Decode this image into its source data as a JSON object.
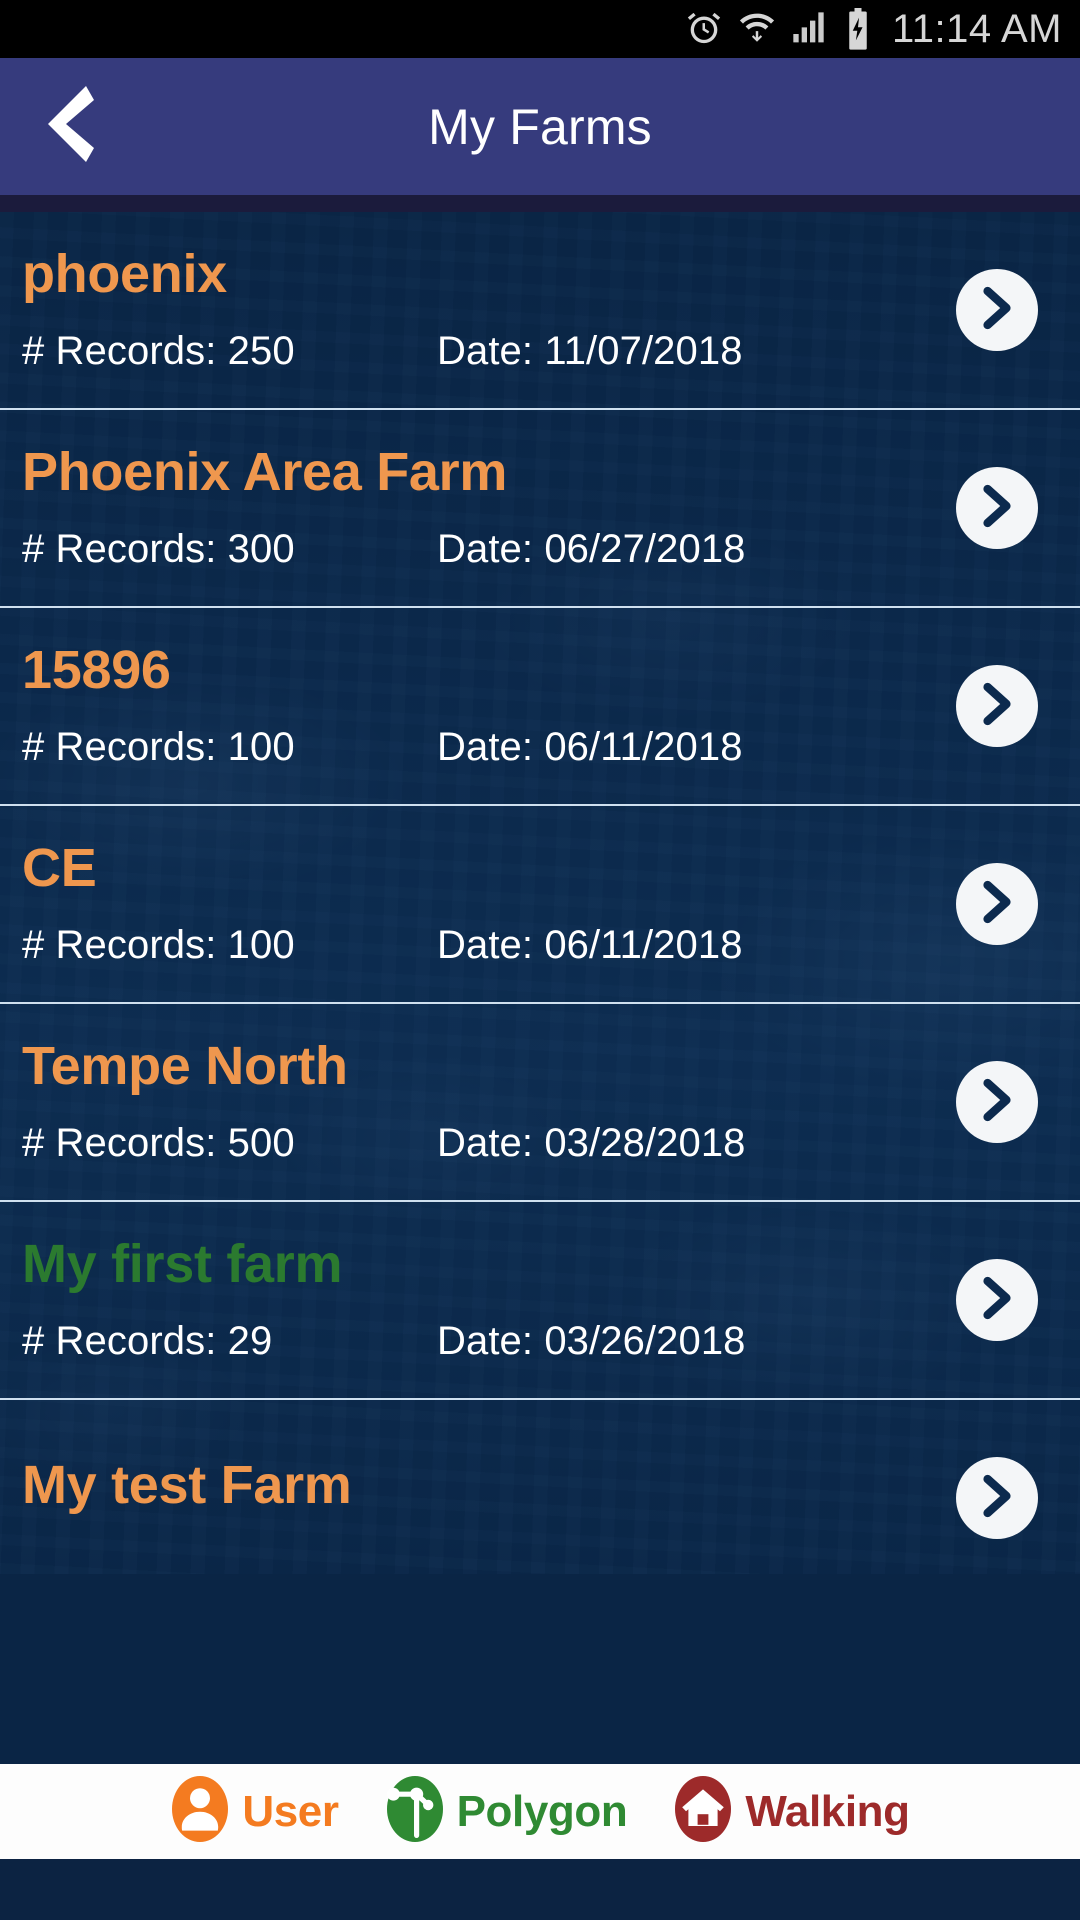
{
  "statusbar": {
    "time": "11:14 AM",
    "icons": [
      "alarm-icon",
      "wifi-icon",
      "signal-icon",
      "battery-charging-icon"
    ]
  },
  "appbar": {
    "title": "My Farms",
    "back_icon": "back-chevron-icon",
    "background": "#363b7d"
  },
  "colors": {
    "accent_orange": "#ef974e",
    "accent_green": "#2b7a2f",
    "list_background": "#0a2545",
    "appbar": "#363b7d",
    "bottombar_user": "#f47b20",
    "bottombar_polygon": "#2f8a33",
    "bottombar_walking": "#9d2a2a"
  },
  "list": {
    "records_prefix": "# Records: ",
    "date_prefix": "Date: ",
    "chevron_icon": "chevron-right-icon",
    "rows": [
      {
        "title": "phoenix",
        "records": "# Records: 250",
        "date": "Date: 11/07/2018",
        "color": "orange"
      },
      {
        "title": "Phoenix Area Farm",
        "records": "# Records: 300",
        "date": "Date: 06/27/2018",
        "color": "orange"
      },
      {
        "title": "15896",
        "records": "# Records: 100",
        "date": "Date: 06/11/2018",
        "color": "orange"
      },
      {
        "title": "CE",
        "records": "# Records: 100",
        "date": "Date: 06/11/2018",
        "color": "orange"
      },
      {
        "title": "Tempe North",
        "records": "# Records: 500",
        "date": "Date: 03/28/2018",
        "color": "orange"
      },
      {
        "title": "My first farm",
        "records": "# Records: 29",
        "date": "Date: 03/26/2018",
        "color": "green"
      },
      {
        "title": "My test Farm",
        "records": "",
        "date": "",
        "color": "orange"
      }
    ]
  },
  "bottombar": {
    "items": [
      {
        "label": "User",
        "icon": "user-avatar-icon"
      },
      {
        "label": "Polygon",
        "icon": "polygon-node-icon"
      },
      {
        "label": "Walking",
        "icon": "home-walking-icon"
      }
    ]
  }
}
